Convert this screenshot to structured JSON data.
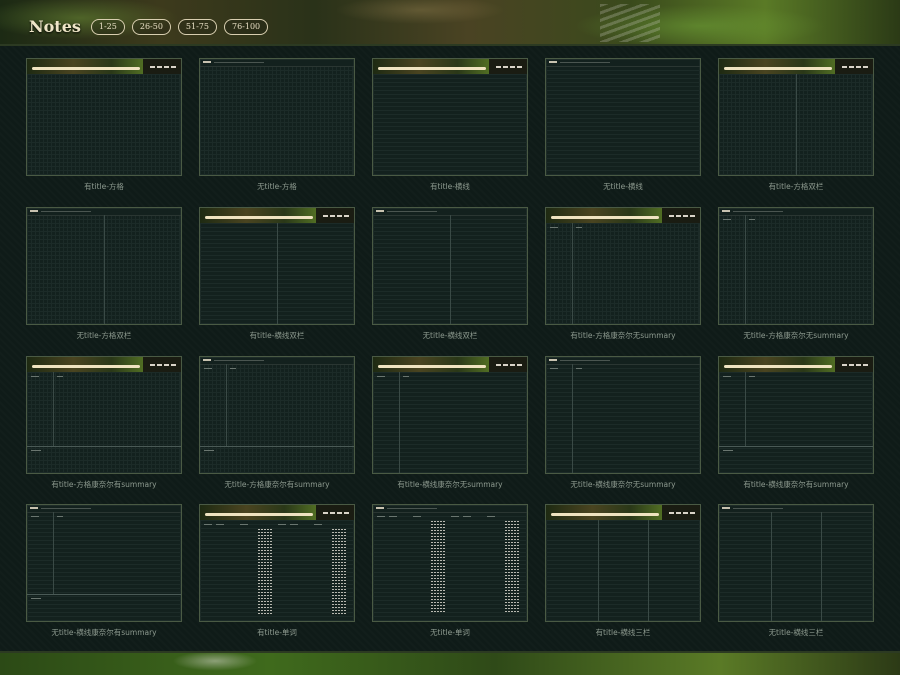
{
  "header": {
    "title": "Notes",
    "tabs": [
      "1-25",
      "26-50",
      "51-75",
      "76-100"
    ]
  },
  "colors": {
    "background": "#0f1b18",
    "accent": "#efe6c8",
    "caption": "#8d9a8f"
  },
  "templates": [
    "有title-方格",
    "无title-方格",
    "有title-横线",
    "无title-横线",
    "有title-方格双栏",
    "无title-方格双栏",
    "有title-横线双栏",
    "无title-横线双栏",
    "有title-方格康奈尔无summary",
    "无title-方格康奈尔无summary",
    "有title-方格康奈尔有summary",
    "无title-方格康奈尔有summary",
    "有title-横线康奈尔无summary",
    "无title-横线康奈尔无summary",
    "有title-横线康奈尔有summary",
    "无title-横线康奈尔有summary",
    "有title-单词",
    "无title-单词",
    "有title-横线三栏",
    "无title-横线三栏"
  ]
}
